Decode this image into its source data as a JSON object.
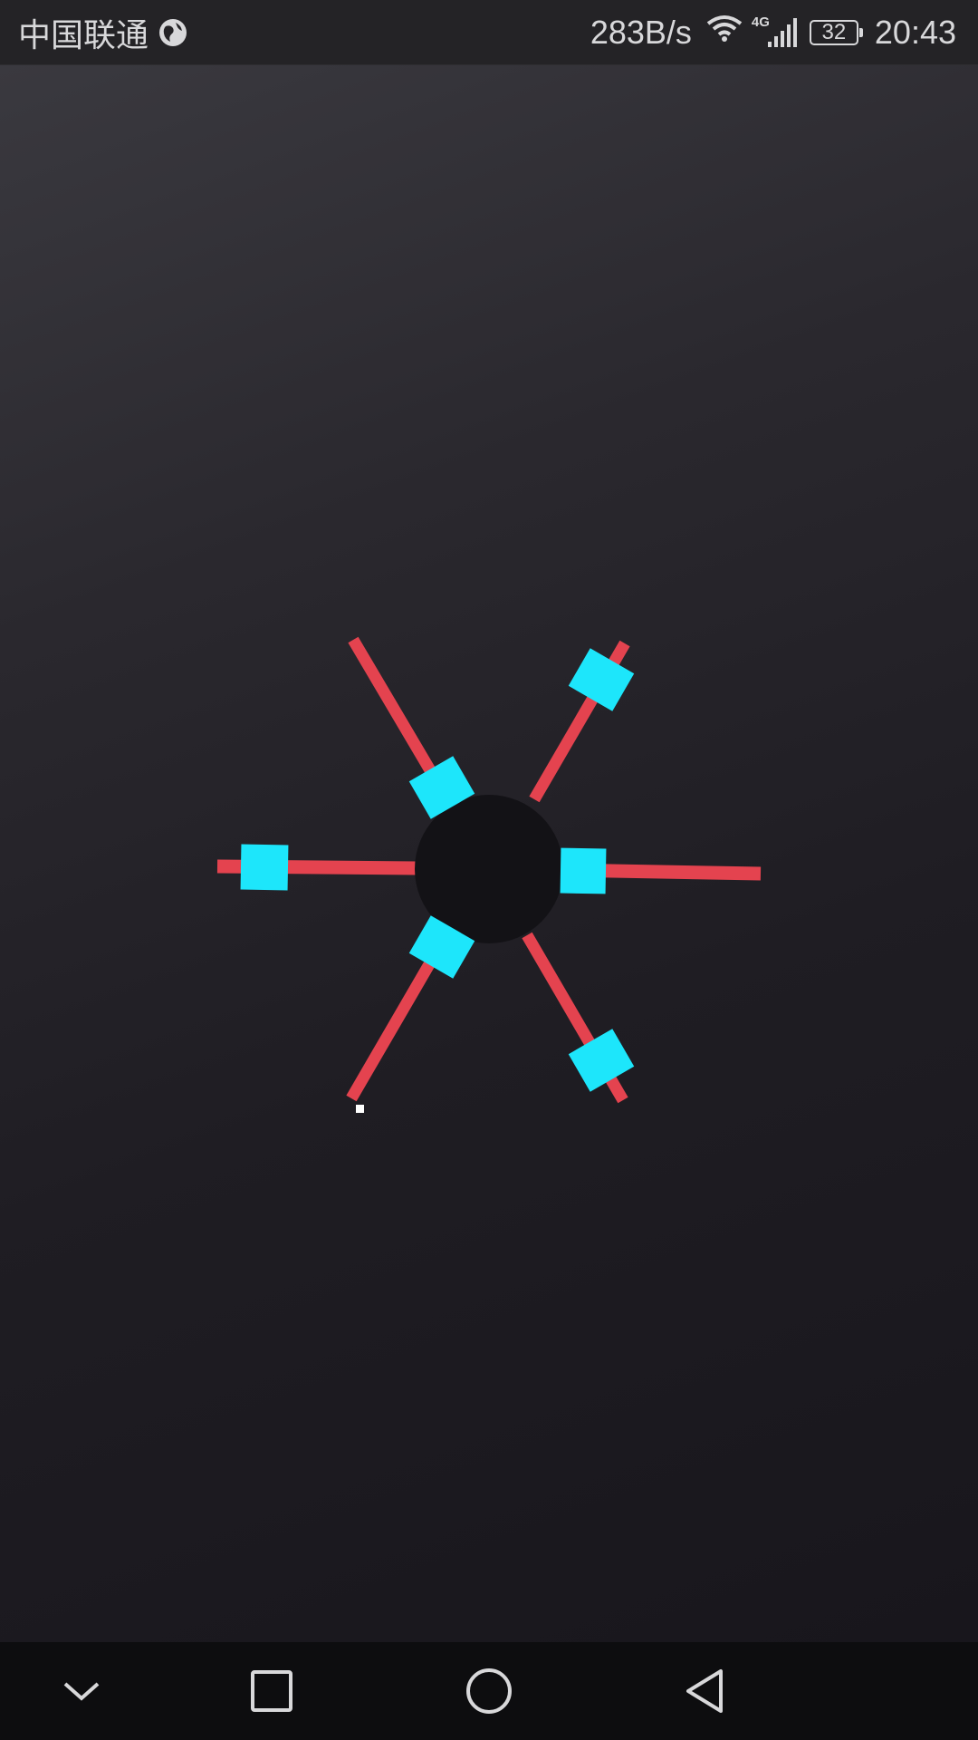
{
  "status_bar": {
    "carrier": "中国联通",
    "carrier_icon": "globe-icon",
    "network_speed": "283B/s",
    "network_type": "4G",
    "battery_level": "32",
    "time": "20:43"
  },
  "game": {
    "colors": {
      "background_top": "#3a393f",
      "background_bottom": "#18161c",
      "hub": "#131216",
      "spoke": "#e4434f",
      "block": "#1de6fb",
      "marker": "#ffffff"
    }
  },
  "nav_bar": {
    "icons": [
      "chevron-down-icon",
      "square-icon",
      "circle-icon",
      "back-triangle-icon"
    ]
  }
}
